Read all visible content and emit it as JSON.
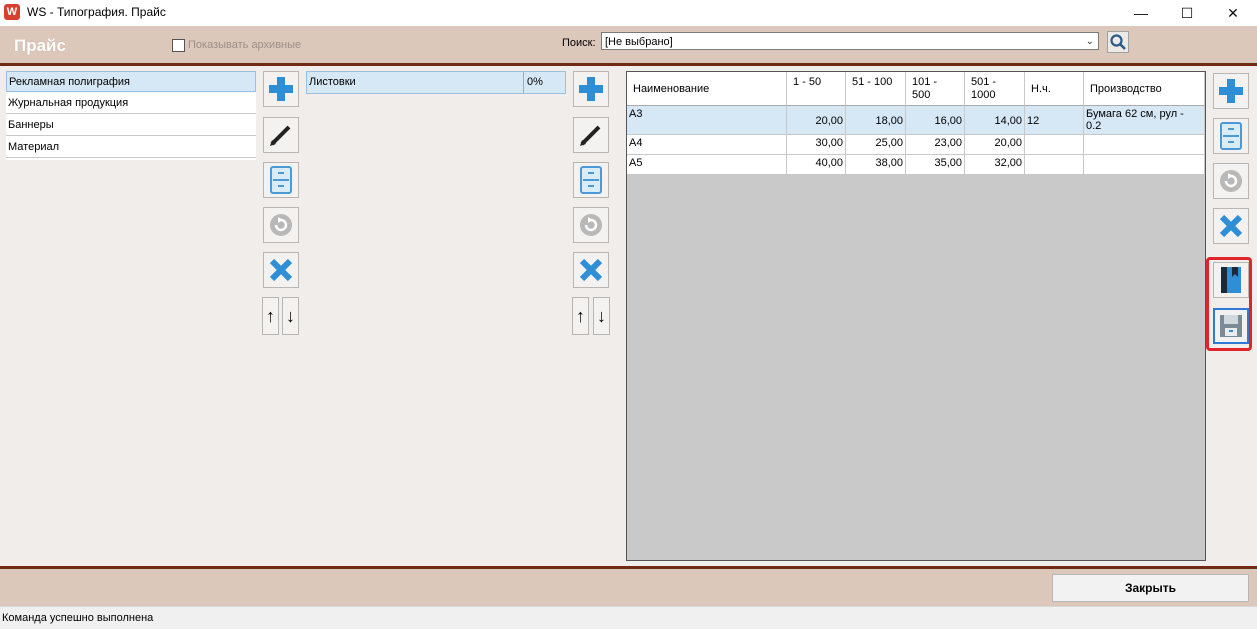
{
  "window": {
    "title": "WS - Типография. Прайс",
    "app_icon": "W",
    "min_glyph": "—",
    "max_glyph": "☐",
    "close_glyph": "✕"
  },
  "header": {
    "title": "Прайс",
    "show_archived_label": "Показывать архивные",
    "search_label": "Поиск:",
    "search_value": "[Не выбрано]"
  },
  "categories": [
    {
      "label": "Рекламная полиграфия",
      "selected": true
    },
    {
      "label": "Журнальная продукция",
      "selected": false
    },
    {
      "label": "Баннеры",
      "selected": false
    },
    {
      "label": "Материал",
      "selected": false
    }
  ],
  "subcategories": [
    {
      "label": "Листовки",
      "percent": "0%",
      "selected": true
    }
  ],
  "arrows": {
    "up": "↑",
    "down": "↓"
  },
  "grid": {
    "columns": [
      "Наименование",
      "1 - 50",
      "51 - 100",
      "101 - 500",
      "501 - 1000",
      "Н.ч.",
      "Производство"
    ],
    "rows": [
      {
        "cells": [
          "А3",
          "20,00",
          "18,00",
          "16,00",
          "14,00",
          "12",
          "Бумага 62 см, рул - 0.2"
        ],
        "selected": true
      },
      {
        "cells": [
          "А4",
          "30,00",
          "25,00",
          "23,00",
          "20,00",
          "",
          ""
        ],
        "selected": false
      },
      {
        "cells": [
          "А5",
          "40,00",
          "38,00",
          "35,00",
          "32,00",
          "",
          ""
        ],
        "selected": false
      }
    ]
  },
  "footer": {
    "close_label": "Закрыть",
    "status": "Команда успешно выполнена"
  },
  "colors": {
    "header_band": "#dcc7bb",
    "accent_line": "#6e2a14",
    "selection": "#d6e7f6",
    "highlight_border": "#e0242c"
  },
  "icons": [
    "plus-icon",
    "pencil-icon",
    "save-icon",
    "refresh-icon",
    "delete-icon",
    "arrow-up-icon",
    "arrow-down-icon",
    "book-icon",
    "disk-icon",
    "search-icon"
  ]
}
